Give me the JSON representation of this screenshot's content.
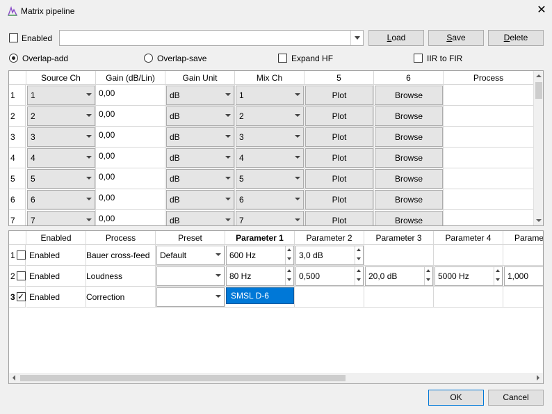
{
  "window": {
    "title": "Matrix pipeline",
    "close": "✕"
  },
  "preset_bar": {
    "enabled_label": "Enabled",
    "preset_value": "",
    "load": "Load",
    "load_key": "L",
    "load_rest": "oad",
    "save_key": "S",
    "save_rest": "ave",
    "delete_key": "D",
    "delete_rest": "elete"
  },
  "options": {
    "overlap_add": "Overlap-add",
    "overlap_save": "Overlap-save",
    "expand_hf": "Expand HF",
    "iir_to_fir": "IIR to FIR"
  },
  "matrix": {
    "headers": [
      "Source Ch",
      "Gain (dB/Lin)",
      "Gain Unit",
      "Mix Ch",
      "5",
      "6",
      "Process"
    ],
    "rows": [
      {
        "n": "1",
        "source": "1",
        "gain": "0,00",
        "unit": "dB",
        "mix": "1",
        "plot": "Plot",
        "browse": "Browse"
      },
      {
        "n": "2",
        "source": "2",
        "gain": "0,00",
        "unit": "dB",
        "mix": "2",
        "plot": "Plot",
        "browse": "Browse"
      },
      {
        "n": "3",
        "source": "3",
        "gain": "0,00",
        "unit": "dB",
        "mix": "3",
        "plot": "Plot",
        "browse": "Browse"
      },
      {
        "n": "4",
        "source": "4",
        "gain": "0,00",
        "unit": "dB",
        "mix": "4",
        "plot": "Plot",
        "browse": "Browse"
      },
      {
        "n": "5",
        "source": "5",
        "gain": "0,00",
        "unit": "dB",
        "mix": "5",
        "plot": "Plot",
        "browse": "Browse"
      },
      {
        "n": "6",
        "source": "6",
        "gain": "0,00",
        "unit": "dB",
        "mix": "6",
        "plot": "Plot",
        "browse": "Browse"
      },
      {
        "n": "7",
        "source": "7",
        "gain": "0,00",
        "unit": "dB",
        "mix": "7",
        "plot": "Plot",
        "browse": "Browse"
      }
    ]
  },
  "process": {
    "headers": [
      "Enabled",
      "Process",
      "Preset",
      "Parameter 1",
      "Parameter 2",
      "Parameter 3",
      "Parameter 4",
      "Parame"
    ],
    "rows": [
      {
        "n": "1",
        "enabled": "Enabled",
        "process": "Bauer cross-feed",
        "preset": "Default",
        "p1": "600 Hz",
        "p2": "3,0 dB",
        "p3": "",
        "p4": "",
        "p5": ""
      },
      {
        "n": "2",
        "enabled": "Enabled",
        "process": "Loudness",
        "preset": "",
        "p1": "80 Hz",
        "p2": "0,500",
        "p3": "20,0 dB",
        "p4": "5000 Hz",
        "p5": "1,000"
      },
      {
        "n": "3",
        "enabled": "Enabled",
        "process": "Correction",
        "preset": "",
        "p1": "SMSL D-6",
        "p2": "",
        "p3": "",
        "p4": "",
        "p5": ""
      }
    ]
  },
  "footer": {
    "ok": "OK",
    "cancel": "Cancel"
  }
}
